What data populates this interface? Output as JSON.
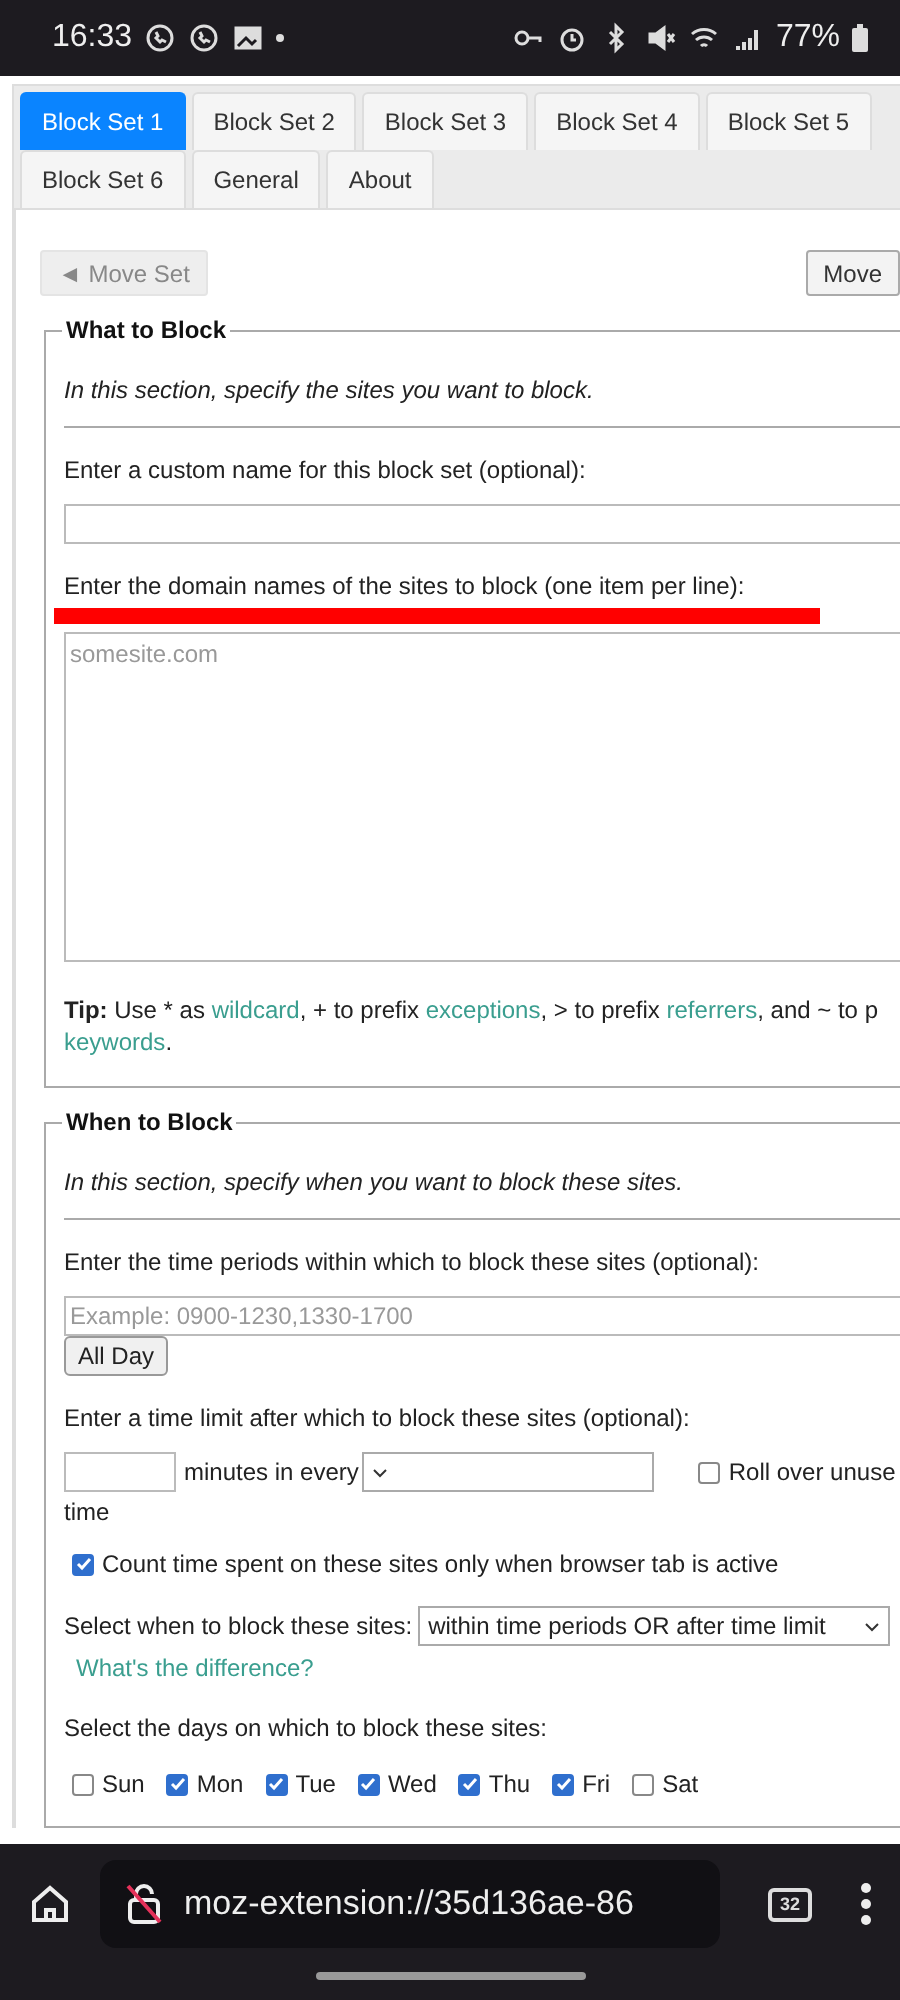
{
  "status_bar": {
    "time": "16:33",
    "battery": "77%"
  },
  "tab_rows": [
    [
      {
        "label": "Block Set 1",
        "selected": true
      },
      {
        "label": "Block Set 2",
        "selected": false
      },
      {
        "label": "Block Set 3",
        "selected": false
      },
      {
        "label": "Block Set 4",
        "selected": false
      },
      {
        "label": "Block Set 5",
        "selected": false
      }
    ],
    [
      {
        "label": "Block Set 6",
        "selected": false
      },
      {
        "label": "General",
        "selected": false
      },
      {
        "label": "About",
        "selected": false
      }
    ]
  ],
  "move_buttons": [
    {
      "label": "◄ Move Set",
      "disabled": true
    },
    {
      "label": "Move",
      "disabled": false
    }
  ],
  "what_to_block": {
    "title": "What to Block",
    "intro": "In this section, specify the sites you want to block.",
    "name_label": "Enter a custom name for this block set (optional):",
    "domains_label": "Enter the domain names of the sites to block (one item per line):",
    "domains_placeholder": "somesite.com",
    "tip": {
      "lead": "Tip:",
      "lines": [
        [
          {
            "text": " Use * as ",
            "link": false
          },
          {
            "text": "wildcard",
            "link": true
          },
          {
            "text": ", + to prefix ",
            "link": false
          },
          {
            "text": "exceptions",
            "link": true
          },
          {
            "text": ", > to prefix ",
            "link": false
          },
          {
            "text": "referrers",
            "link": true
          },
          {
            "text": ", and ~ to p",
            "link": false
          }
        ],
        [
          {
            "text": "keywords",
            "link": true
          },
          {
            "text": ".",
            "link": false
          }
        ]
      ]
    }
  },
  "when_to_block": {
    "title": "When to Block",
    "intro": "In this section, specify when you want to block these sites.",
    "periods_label": "Enter the time periods within which to block these sites (optional):",
    "periods_placeholder": "Example: 0900-1230,1330-1700",
    "all_day_button": "All Day",
    "limit_label": "Enter a time limit after which to block these sites (optional):",
    "minutes_text": "minutes in every",
    "rollover": {
      "label": "Roll over unuse",
      "label_continued": "time",
      "checked": false
    },
    "count_active": {
      "label": "Count time spent on these sites only when browser tab is active",
      "checked": true
    },
    "mode_label": "Select when to block these sites:",
    "mode_value": "within time periods OR after time limit",
    "difference_link": "What's the difference?",
    "days_label": "Select the days on which to block these sites:",
    "days": [
      {
        "label": "Sun",
        "checked": false
      },
      {
        "label": "Mon",
        "checked": true
      },
      {
        "label": "Tue",
        "checked": true
      },
      {
        "label": "Wed",
        "checked": true
      },
      {
        "label": "Thu",
        "checked": true
      },
      {
        "label": "Fri",
        "checked": true
      },
      {
        "label": "Sat",
        "checked": false
      }
    ]
  },
  "browser_bar": {
    "url": "moz-extension://35d136ae-86",
    "tab_count": "32"
  }
}
